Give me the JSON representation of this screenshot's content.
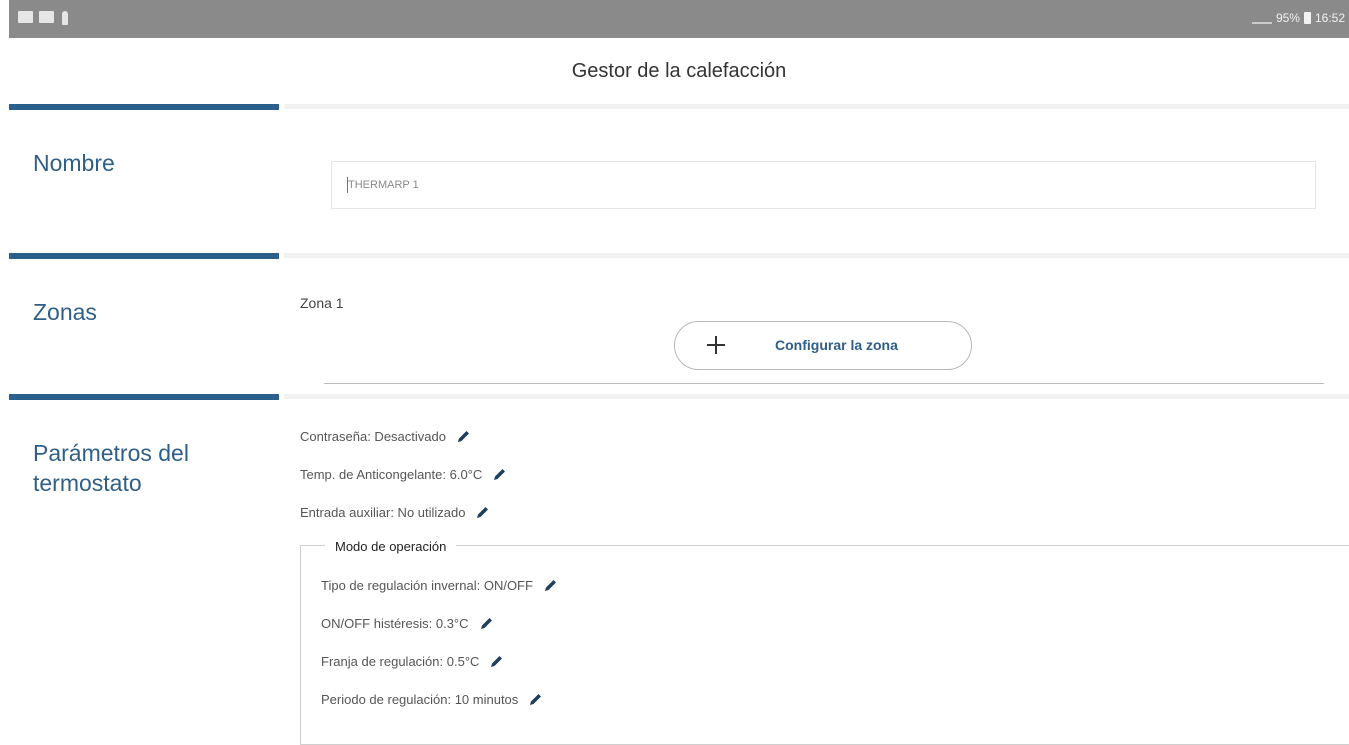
{
  "status_bar": {
    "battery": "95%",
    "time": "16:52"
  },
  "app_bar": {
    "title": "Gestor de la calefacción"
  },
  "sections": {
    "nombre": {
      "title": "Nombre",
      "input_value": "THERMARP 1"
    },
    "zonas": {
      "title": "Zonas",
      "zone_name": "Zona 1",
      "config_button_label": "Configurar la zona"
    },
    "parametros": {
      "title": "Parámetros del termostato",
      "rows": [
        "Contraseña: Desactivado",
        "Temp. de Anticongelante: 6.0°C",
        "Entrada auxiliar: No utilizado"
      ],
      "mode": {
        "legend": "Modo de operación",
        "rows": [
          "Tipo de regulación invernal: ON/OFF",
          "ON/OFF histéresis: 0.3°C",
          "Franja de regulación: 0.5°C",
          "Periodo de regulación: 10 minutos"
        ]
      }
    }
  },
  "colors": {
    "accent": "#2b5f8c",
    "title_text": "#2f5f86",
    "status_bar": "#8a8a8a"
  },
  "icons": {
    "edit": "pencil-icon",
    "add": "plus-icon"
  }
}
